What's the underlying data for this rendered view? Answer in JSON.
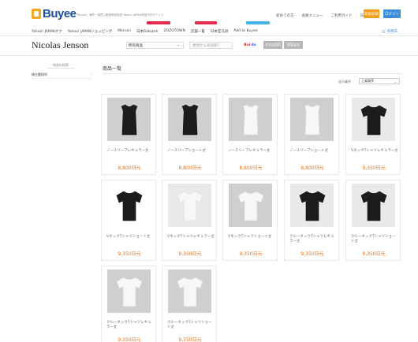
{
  "header": {
    "logo_text": "Buyee",
    "tagline": "「Buyee」海外一括買い取扱商品配送 Yahoo! JAPAN商品代行サービス",
    "nav": [
      "初めての方",
      "会員メニュー",
      "ご利用ガイド",
      "日本語"
    ],
    "login_label": "ログイン",
    "register_label": "新規登録",
    "subnav": [
      "Yahoo! JAPANオク",
      "Yahoo! JAPANショッピング",
      "Mercari",
      "日本Rakuten",
      "ZOZOTOWN",
      "店舗一覧",
      "日本亚马逊",
      "Add to Buyee"
    ],
    "cart_label": "购物车"
  },
  "store": {
    "name": "Nicolas Jenson",
    "category_select": "所有商品",
    "search_placeholder": "想找什么商品呢?",
    "baidu_left": "Bai",
    "baidu_right": "du",
    "search_btn_1": "在本店搜索",
    "search_btn_2": "搜索全站"
  },
  "sidebar": {
    "title": "按类别搜索",
    "items": [
      {
        "label": "按主题排列"
      }
    ]
  },
  "content": {
    "title": "商品一覧",
    "sort_label": "显示顺序",
    "sort_value": "上架顺序",
    "products": [
      {
        "name": "ノースリーブレギュラー丈",
        "price": "8,800日元",
        "color": "black",
        "style": "sleeveless",
        "bg": "gray"
      },
      {
        "name": "ノースリーブショート丈",
        "price": "8,800日元",
        "color": "black",
        "style": "sleeveless",
        "bg": "gray"
      },
      {
        "name": "ノースリーブレギュラー丈",
        "price": "8,800日元",
        "color": "white",
        "style": "sleeveless",
        "bg": "gray"
      },
      {
        "name": "ノースリーブショート丈",
        "price": "8,800日元",
        "color": "white",
        "style": "sleeveless",
        "bg": "gray"
      },
      {
        "name": "VネックTシャツレギュラー丈",
        "price": "9,350日元",
        "color": "black",
        "style": "tshirt",
        "bg": "light"
      },
      {
        "name": "VネックTシャツショート丈",
        "price": "9,350日元",
        "color": "black",
        "style": "tshirt",
        "bg": "white"
      },
      {
        "name": "VネックTシャツレギュラー丈",
        "price": "9,350日元",
        "color": "white",
        "style": "tshirt",
        "bg": "light"
      },
      {
        "name": "VネックTシャツショート丈",
        "price": "9,350日元",
        "color": "white",
        "style": "tshirt",
        "bg": "gray"
      },
      {
        "name": "クルーネックTシャツレギュラー丈",
        "price": "9,350日元",
        "color": "black",
        "style": "tshirt",
        "bg": "light"
      },
      {
        "name": "クルーネックTシャツショート丈",
        "price": "9,350日元",
        "color": "black",
        "style": "tshirt",
        "bg": "light"
      },
      {
        "name": "クルーネックTシャツレギュラー丈",
        "price": "9,350日元",
        "color": "white",
        "style": "tshirt",
        "bg": "gray"
      },
      {
        "name": "クルーネックTシャツショート丈",
        "price": "9,350日元",
        "color": "white",
        "style": "tshirt",
        "bg": "gray"
      }
    ]
  },
  "colors": {
    "brand_blue": "#1a4f9c",
    "brand_orange": "#f6a623",
    "price_orange": "#e3701a",
    "shirt_black": "#1c1c1c",
    "shirt_white": "#f7f7f7"
  }
}
